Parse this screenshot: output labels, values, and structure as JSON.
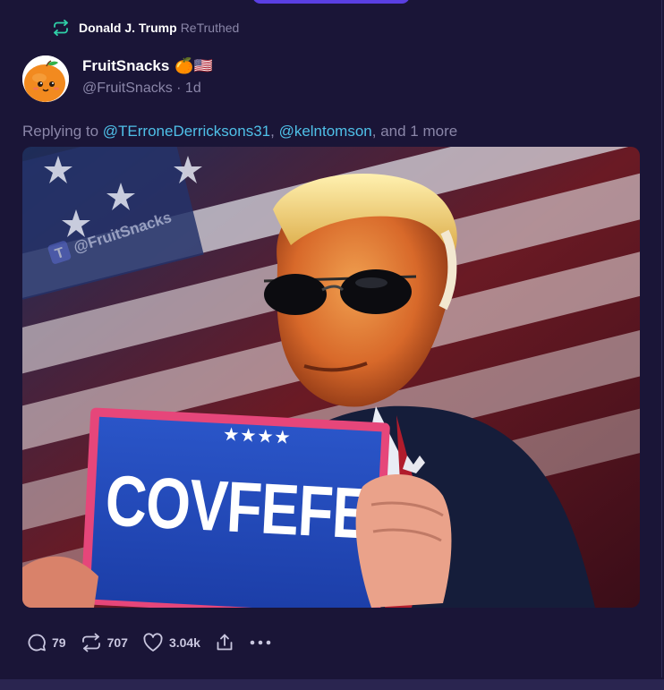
{
  "retruth": {
    "name": "Donald J. Trump",
    "label": "ReTruthed"
  },
  "post": {
    "display_name": "FruitSnacks",
    "name_emoji": "🍊🇺🇸",
    "meta": "@FruitSnacks · 1d",
    "reply_prefix": "Replying to ",
    "mentions": [
      "@TErroneDerricksons31",
      "@kelntomson"
    ],
    "reply_sep": ", ",
    "reply_suffix": ", and 1 more",
    "image": {
      "watermark": "@FruitSnacks",
      "sign_text": "COVFEFE"
    }
  },
  "actions": {
    "replies": "79",
    "retruths": "707",
    "likes": "3.04k"
  },
  "colors": {
    "background": "#1a1537",
    "mention": "#4fc0e8",
    "accent": "#5a3fe2",
    "retruth_icon": "#2fd0a8"
  }
}
